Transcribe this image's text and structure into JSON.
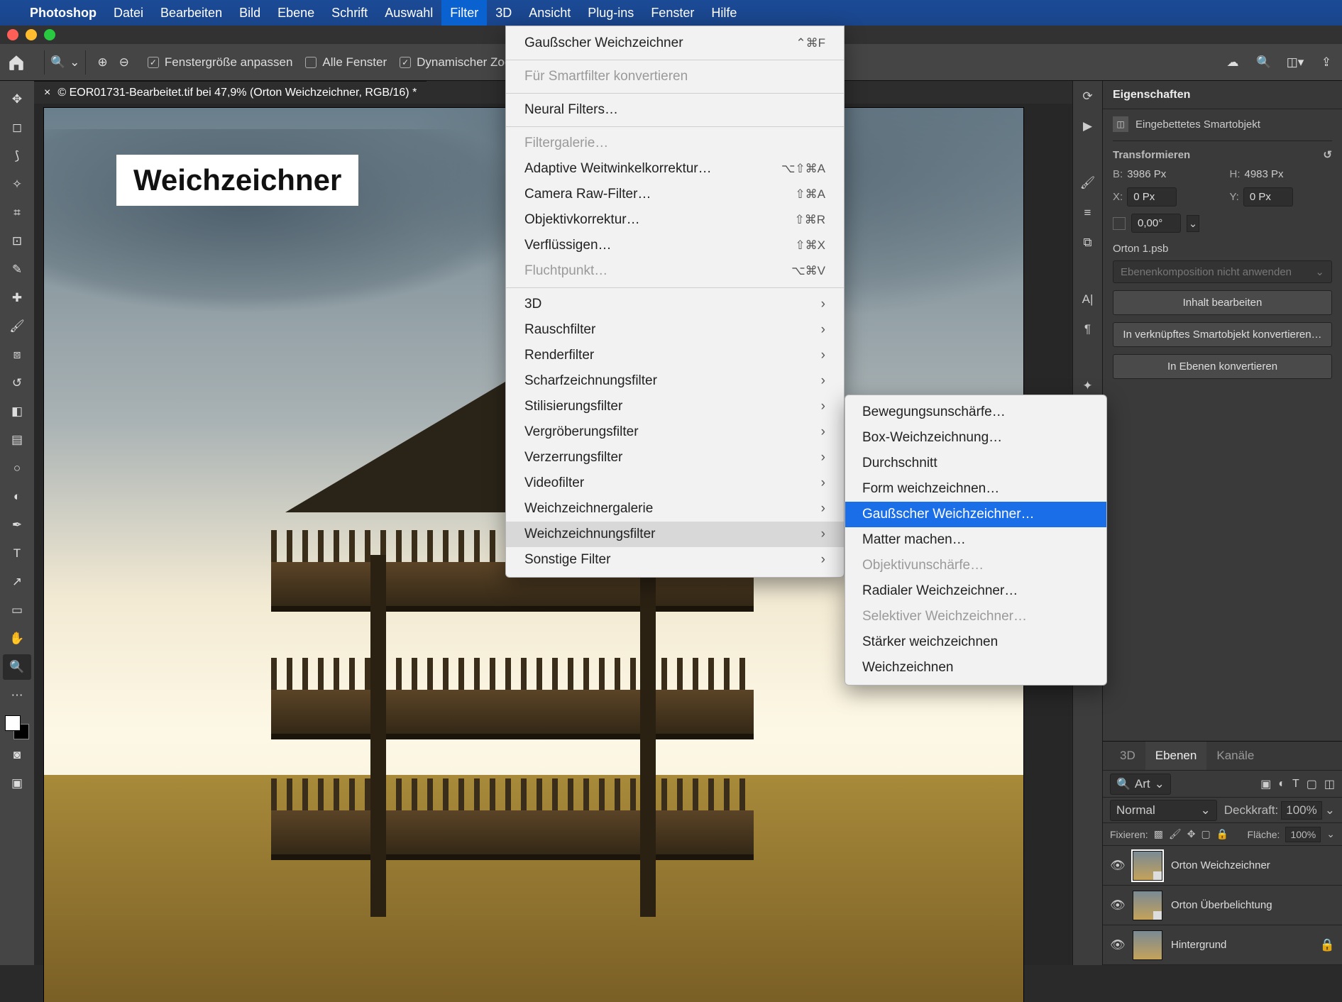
{
  "menubar": {
    "app": "Photoshop",
    "items": [
      "Datei",
      "Bearbeiten",
      "Bild",
      "Ebene",
      "Schrift",
      "Auswahl",
      "Filter",
      "3D",
      "Ansicht",
      "Plug-ins",
      "Fenster",
      "Hilfe"
    ],
    "active": "Filter"
  },
  "options": {
    "fit_window": "Fenstergröße anpassen",
    "all_windows": "Alle Fenster",
    "dynamic_zoom": "Dynamischer Zoom"
  },
  "doc_tab": {
    "title": "© EOR01731-Bearbeitet.tif bei 47,9% (Orton Weichzeichner, RGB/16) *"
  },
  "overlay": "Weichzeichner",
  "filter_menu": {
    "last": "Gaußscher Weichzeichner",
    "last_sc": "⌃⌘F",
    "smart": "Für Smartfilter konvertieren",
    "neural": "Neural Filters…",
    "gallery": "Filtergalerie…",
    "adaptive": "Adaptive Weitwinkelkorrektur…",
    "adaptive_sc": "⌥⇧⌘A",
    "camera_raw": "Camera Raw-Filter…",
    "camera_raw_sc": "⇧⌘A",
    "lens": "Objektivkorrektur…",
    "lens_sc": "⇧⌘R",
    "liquify": "Verflüssigen…",
    "liquify_sc": "⇧⌘X",
    "vanish": "Fluchtpunkt…",
    "vanish_sc": "⌥⌘V",
    "sub_3d": "3D",
    "noise": "Rauschfilter",
    "render": "Renderfilter",
    "sharpen": "Scharfzeichnungsfilter",
    "stylize": "Stilisierungsfilter",
    "magnify": "Vergröberungsfilter",
    "distort": "Verzerrungsfilter",
    "video": "Videofilter",
    "blur_gal": "Weichzeichnergalerie",
    "blur": "Weichzeichnungsfilter",
    "other": "Sonstige Filter"
  },
  "submenu": {
    "motion": "Bewegungsunschärfe…",
    "box": "Box-Weichzeichnung…",
    "avg": "Durchschnitt",
    "shape": "Form weichzeichnen…",
    "gauss": "Gaußscher Weichzeichner…",
    "matte": "Matter machen…",
    "lensblur": "Objektivunschärfe…",
    "radial": "Radialer Weichzeichner…",
    "selective": "Selektiver Weichzeichner…",
    "more": "Stärker weichzeichnen",
    "blur": "Weichzeichnen"
  },
  "properties": {
    "title": "Eigenschaften",
    "so_label": "Eingebettetes Smartobjekt",
    "transform": "Transformieren",
    "w_lab": "B:",
    "w_val": "3986 Px",
    "h_lab": "H:",
    "h_val": "4983 Px",
    "x_lab": "X:",
    "x_val": "0 Px",
    "y_lab": "Y:",
    "y_val": "0 Px",
    "angle": "0,00°",
    "linked_file": "Orton 1.psb",
    "comp_placeholder": "Ebenenkomposition nicht anwenden",
    "btn_edit": "Inhalt bearbeiten",
    "btn_convert_linked": "In verknüpftes Smartobjekt konvertieren…",
    "btn_convert_layers": "In Ebenen konvertieren"
  },
  "layers": {
    "tab_3d": "3D",
    "tab_layers": "Ebenen",
    "tab_channels": "Kanäle",
    "search_mode": "Art",
    "blend": "Normal",
    "opacity_label": "Deckkraft:",
    "opacity_val": "100%",
    "lock_label": "Fixieren:",
    "fill_label": "Fläche:",
    "fill_val": "100%",
    "rows": [
      {
        "name": "Orton Weichzeichner",
        "selected": true,
        "locked": false
      },
      {
        "name": "Orton Überbelichtung",
        "selected": false,
        "locked": false
      },
      {
        "name": "Hintergrund",
        "selected": false,
        "locked": true
      }
    ]
  }
}
